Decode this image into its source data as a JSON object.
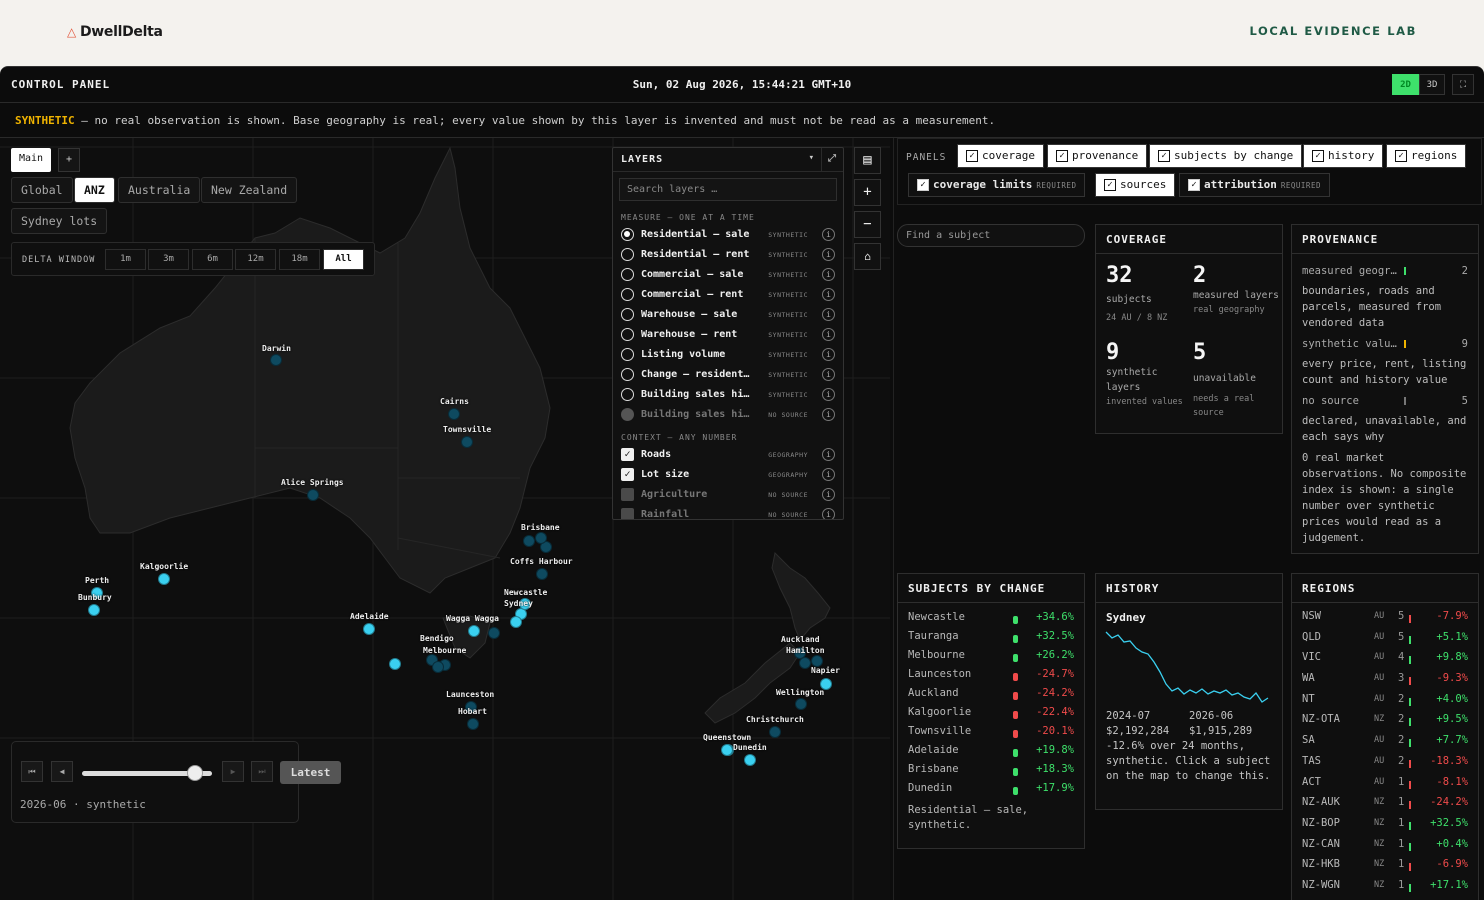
{
  "brand": {
    "name": "DwellDelta",
    "tagline": "LOCAL EVIDENCE LAB"
  },
  "header": {
    "title": "CONTROL PANEL",
    "clock": "Sun, 02 Aug 2026, 15:44:21 GMT+10",
    "view_2d": "2D",
    "view_3d": "3D"
  },
  "warning": {
    "label": "SYNTHETIC",
    "text": " — no real observation is shown. Base geography is real; every value shown by this layer is invented and must not be read as a measurement."
  },
  "map": {
    "tab_main": "Main",
    "tab_add": "+",
    "regions": [
      "Global",
      "ANZ",
      "Australia",
      "New Zealand",
      "Sydney lots"
    ],
    "active_region": "ANZ",
    "delta_label": "DELTA WINDOW",
    "delta_options": [
      "1m",
      "3m",
      "6m",
      "12m",
      "18m",
      "All"
    ],
    "active_delta": "All",
    "cities": [
      "Darwin",
      "Cairns",
      "Townsville",
      "Alice Springs",
      "Brisbane",
      "Coffs Harbour",
      "Kalgoorlie",
      "Perth",
      "Bunbury",
      "Newcastle",
      "Sydney",
      "Wagga Wagga",
      "Adelaide",
      "Bendigo",
      "Melbourne",
      "Launceston",
      "Hobart",
      "Auckland",
      "Hamilton",
      "Napier",
      "Wellington",
      "Christchurch",
      "Queenstown",
      "Dunedin"
    ]
  },
  "layers": {
    "title": "LAYERS",
    "search_placeholder": "Search layers …",
    "measure_label": "MEASURE — ONE AT A TIME",
    "measures": [
      {
        "name": "Residential — sale",
        "tag": "SYNTHETIC"
      },
      {
        "name": "Residential — rent",
        "tag": "SYNTHETIC"
      },
      {
        "name": "Commercial — sale",
        "tag": "SYNTHETIC"
      },
      {
        "name": "Commercial — rent",
        "tag": "SYNTHETIC"
      },
      {
        "name": "Warehouse — sale",
        "tag": "SYNTHETIC"
      },
      {
        "name": "Warehouse — rent",
        "tag": "SYNTHETIC"
      },
      {
        "name": "Listing volume",
        "tag": "SYNTHETIC"
      },
      {
        "name": "Change — residential",
        "tag": "SYNTHETIC"
      },
      {
        "name": "Building sales history",
        "tag": "SYNTHETIC"
      },
      {
        "name": "Building sales history",
        "tag": "NO SOURCE"
      }
    ],
    "context_label": "CONTEXT — ANY NUMBER",
    "context": [
      {
        "name": "Roads",
        "tag": "GEOGRAPHY"
      },
      {
        "name": "Lot size",
        "tag": "GEOGRAPHY"
      },
      {
        "name": "Agriculture",
        "tag": "NO SOURCE"
      },
      {
        "name": "Rainfall",
        "tag": "NO SOURCE"
      }
    ]
  },
  "playback": {
    "latest": "Latest",
    "status": "2026-06 · synthetic",
    "position": 0.87
  },
  "panels": {
    "label": "PANELS",
    "chips": [
      "coverage",
      "provenance",
      "subjects by change",
      "history",
      "regions",
      "coverage limits",
      "sources",
      "attribution"
    ],
    "required": "REQUIRED"
  },
  "find_placeholder": "Find a subject",
  "coverage": {
    "title": "COVERAGE",
    "subjects": "32",
    "subjects_label": "subjects",
    "subjects_sub": "24 AU / 8 NZ",
    "measured": "2",
    "measured_label": "measured layers",
    "measured_sub": "real geography",
    "synthetic": "9",
    "synthetic_label": "synthetic layers",
    "synthetic_sub": "invented values",
    "unavailable": "5",
    "unavailable_label": "unavailable",
    "unavailable_sub": "needs a real source"
  },
  "provenance": {
    "title": "PROVENANCE",
    "r1": "measured geogr…",
    "r1n": "2",
    "r1d": "boundaries, roads and parcels, measured from vendored data",
    "r2": "synthetic valu…",
    "r2n": "9",
    "r2d": "every price, rent, listing count and history value",
    "r3": "no source",
    "r3n": "5",
    "r3d": "declared, unavailable, and each says why",
    "note": "0 real market observations. No composite index is shown: a single number over synthetic prices would read as a judgement."
  },
  "subjects_by_change": {
    "title": "SUBJECTS BY CHANGE",
    "rows": [
      {
        "name": "Newcastle",
        "value": "+34.6%"
      },
      {
        "name": "Tauranga",
        "value": "+32.5%"
      },
      {
        "name": "Melbourne",
        "value": "+26.2%"
      },
      {
        "name": "Launceston",
        "value": "-24.7%"
      },
      {
        "name": "Auckland",
        "value": "-24.2%"
      },
      {
        "name": "Kalgoorlie",
        "value": "-22.4%"
      },
      {
        "name": "Townsville",
        "value": "-20.1%"
      },
      {
        "name": "Adelaide",
        "value": "+19.8%"
      },
      {
        "name": "Brisbane",
        "value": "+18.3%"
      },
      {
        "name": "Dunedin",
        "value": "+17.9%"
      }
    ],
    "footer": "Residential — sale, synthetic."
  },
  "history": {
    "title": "HISTORY",
    "subject": "Sydney",
    "start_date": "2024-07",
    "end_date": "2026-06",
    "start_value": "$2,192,284",
    "end_value": "$1,915,289",
    "summary": "-12.6% over 24 months, synthetic. Click a subject on the map to change this."
  },
  "regions_table": {
    "title": "REGIONS",
    "rows": [
      {
        "name": "NSW",
        "cc": "AU",
        "n": "5",
        "value": "-7.9%"
      },
      {
        "name": "QLD",
        "cc": "AU",
        "n": "5",
        "value": "+5.1%"
      },
      {
        "name": "VIC",
        "cc": "AU",
        "n": "4",
        "value": "+9.8%"
      },
      {
        "name": "WA",
        "cc": "AU",
        "n": "3",
        "value": "-9.3%"
      },
      {
        "name": "NT",
        "cc": "AU",
        "n": "2",
        "value": "+4.0%"
      },
      {
        "name": "NZ-OTA",
        "cc": "NZ",
        "n": "2",
        "value": "+9.5%"
      },
      {
        "name": "SA",
        "cc": "AU",
        "n": "2",
        "value": "+7.7%"
      },
      {
        "name": "TAS",
        "cc": "AU",
        "n": "2",
        "value": "-18.3%"
      },
      {
        "name": "ACT",
        "cc": "AU",
        "n": "1",
        "value": "-8.1%"
      },
      {
        "name": "NZ-AUK",
        "cc": "NZ",
        "n": "1",
        "value": "-24.2%"
      },
      {
        "name": "NZ-BOP",
        "cc": "NZ",
        "n": "1",
        "value": "+32.5%"
      },
      {
        "name": "NZ-CAN",
        "cc": "NZ",
        "n": "1",
        "value": "+0.4%"
      },
      {
        "name": "NZ-HKB",
        "cc": "NZ",
        "n": "1",
        "value": "-6.9%"
      },
      {
        "name": "NZ-WGN",
        "cc": "NZ",
        "n": "1",
        "value": "+17.1%"
      }
    ]
  },
  "colors": {
    "positive": "#3ee06b",
    "negative": "#f04b4b",
    "warning": "#f0b400",
    "marker": "#3ad0f0"
  }
}
